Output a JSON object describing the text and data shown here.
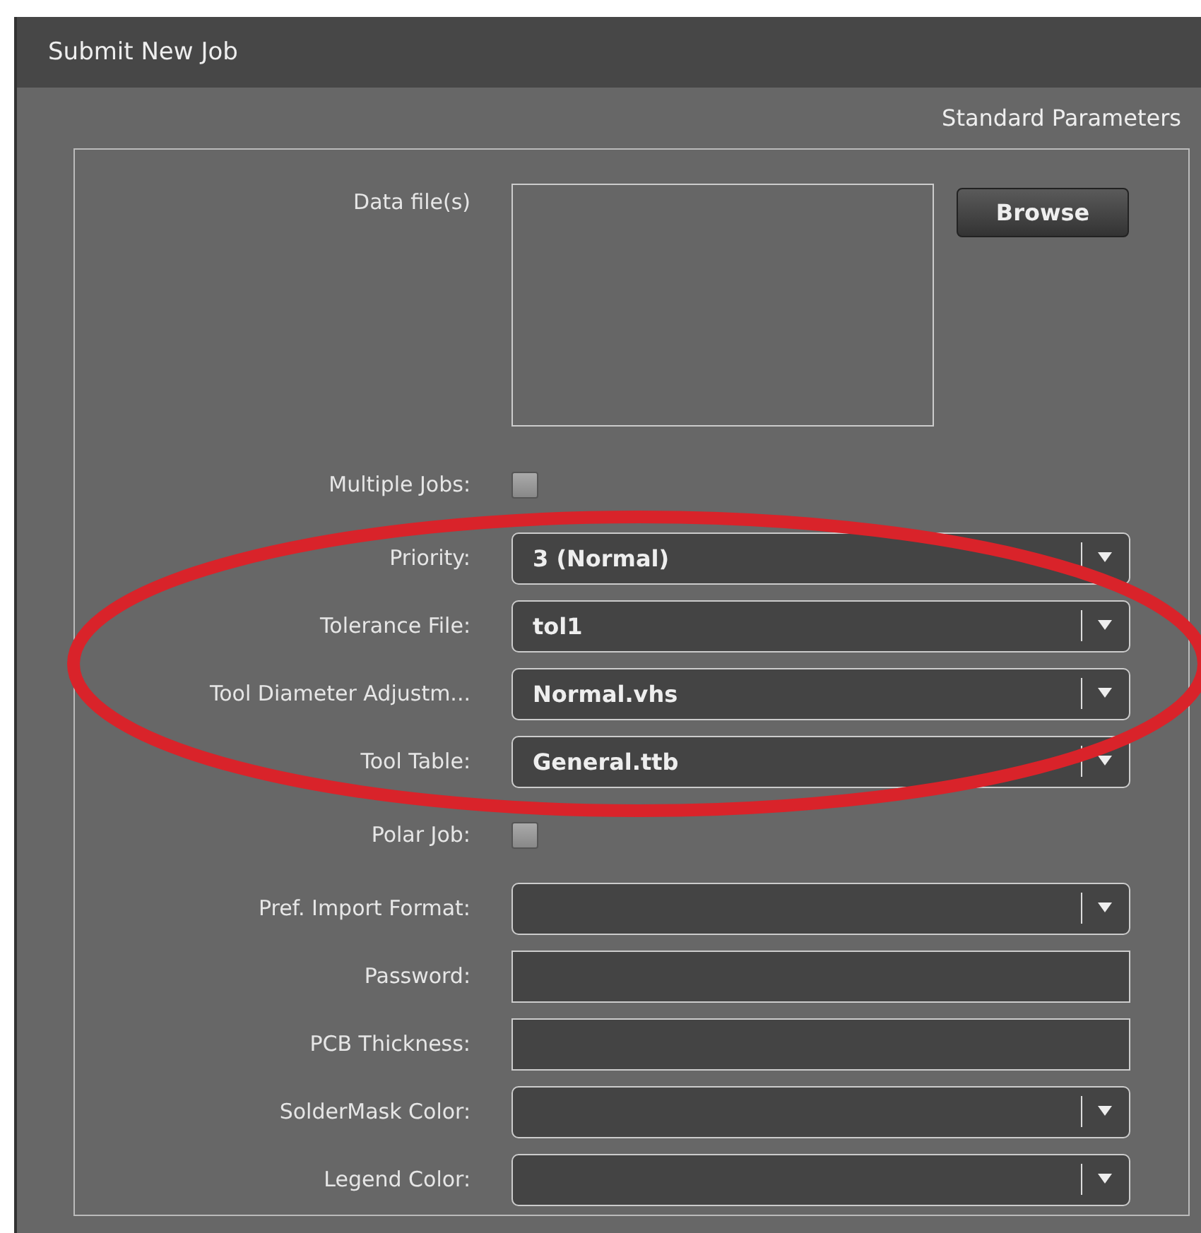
{
  "window": {
    "title": "Submit New Job"
  },
  "section_title": "Standard Parameters",
  "data_files": {
    "label": "Data file(s)",
    "button": "Browse"
  },
  "fields": [
    {
      "label": "Multiple Jobs:",
      "kind": "checkbox",
      "checked": false
    },
    {
      "label": "Priority:",
      "kind": "dropdown",
      "value": "3 (Normal)"
    },
    {
      "label": "Tolerance File:",
      "kind": "dropdown",
      "value": "tol1"
    },
    {
      "label": "Tool Diameter Adjustm...",
      "kind": "dropdown",
      "value": "Normal.vhs"
    },
    {
      "label": "Tool Table:",
      "kind": "dropdown",
      "value": "General.ttb"
    },
    {
      "label": "Polar Job:",
      "kind": "checkbox",
      "checked": false
    },
    {
      "label": "Pref. Import Format:",
      "kind": "dropdown"
    },
    {
      "label": "Password:",
      "kind": "text"
    },
    {
      "label": "PCB Thickness:",
      "kind": "text"
    },
    {
      "label": "SolderMask Color:",
      "kind": "dropdown"
    },
    {
      "label": "Legend Color:",
      "kind": "dropdown"
    }
  ],
  "annotation": {
    "kind": "ellipse",
    "color": "#d9232a"
  }
}
